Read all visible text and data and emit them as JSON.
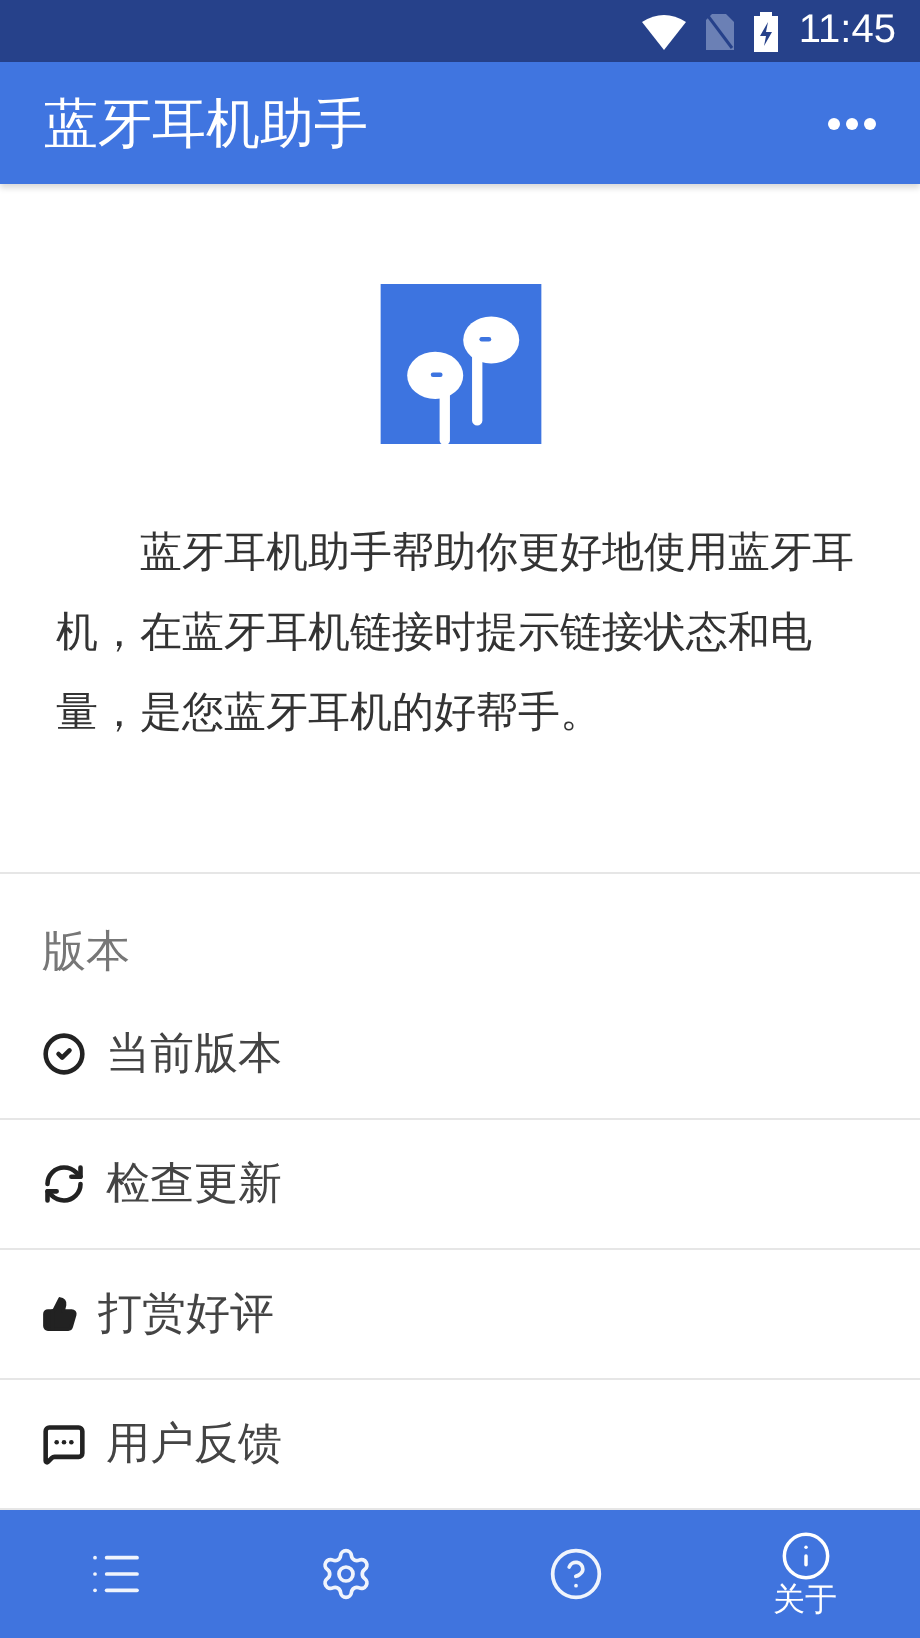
{
  "status_bar": {
    "time": "11:45"
  },
  "app_bar": {
    "title": "蓝牙耳机助手"
  },
  "intro": {
    "text": "蓝牙耳机助手帮助你更好地使用蓝牙耳机，在蓝牙耳机链接时提示链接状态和电量，是您蓝牙耳机的好帮手。"
  },
  "section": {
    "title": "版本"
  },
  "rows": [
    {
      "kind": "version",
      "label": "当前版本"
    },
    {
      "kind": "update",
      "label": "检查更新"
    },
    {
      "kind": "like",
      "label": "打赏好评"
    },
    {
      "kind": "feedback",
      "label": "用户反馈"
    }
  ],
  "bottom_nav": [
    {
      "kind": "list",
      "selected": false
    },
    {
      "kind": "settings",
      "selected": false
    },
    {
      "kind": "help",
      "selected": false
    },
    {
      "kind": "info",
      "selected": true,
      "label": "关于"
    }
  ]
}
